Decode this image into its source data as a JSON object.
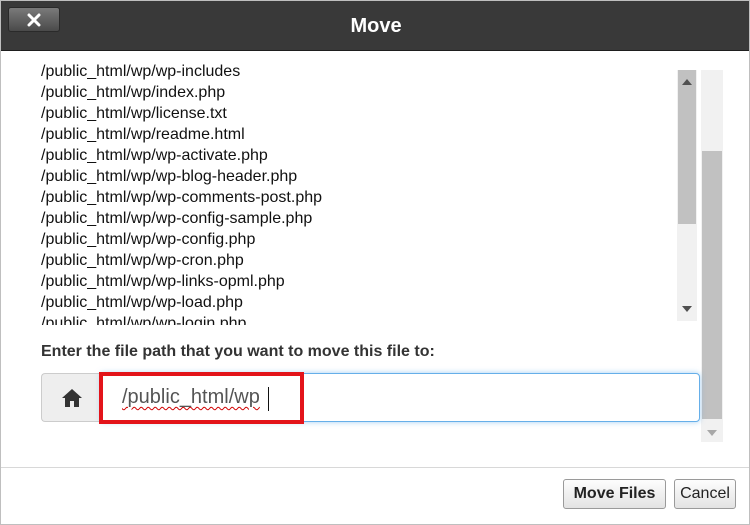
{
  "dialog": {
    "title": "Move",
    "close_icon": "close-icon"
  },
  "file_list": [
    "/public_html/wp/wp-includes",
    "/public_html/wp/index.php",
    "/public_html/wp/license.txt",
    "/public_html/wp/readme.html",
    "/public_html/wp/wp-activate.php",
    "/public_html/wp/wp-blog-header.php",
    "/public_html/wp/wp-comments-post.php",
    "/public_html/wp/wp-config-sample.php",
    "/public_html/wp/wp-config.php",
    "/public_html/wp/wp-cron.php",
    "/public_html/wp/wp-links-opml.php",
    "/public_html/wp/wp-load.php",
    "/public_html/wp/wp-login.php"
  ],
  "destination": {
    "prompt": "Enter the file path that you want to move this file to:",
    "home_icon": "home-icon",
    "value": "/public_html/wp"
  },
  "buttons": {
    "move_files": "Move Files",
    "cancel": "Cancel"
  },
  "colors": {
    "title_bar": "#393939",
    "highlight": "#e3141a",
    "input_focus": "#66afe9"
  }
}
